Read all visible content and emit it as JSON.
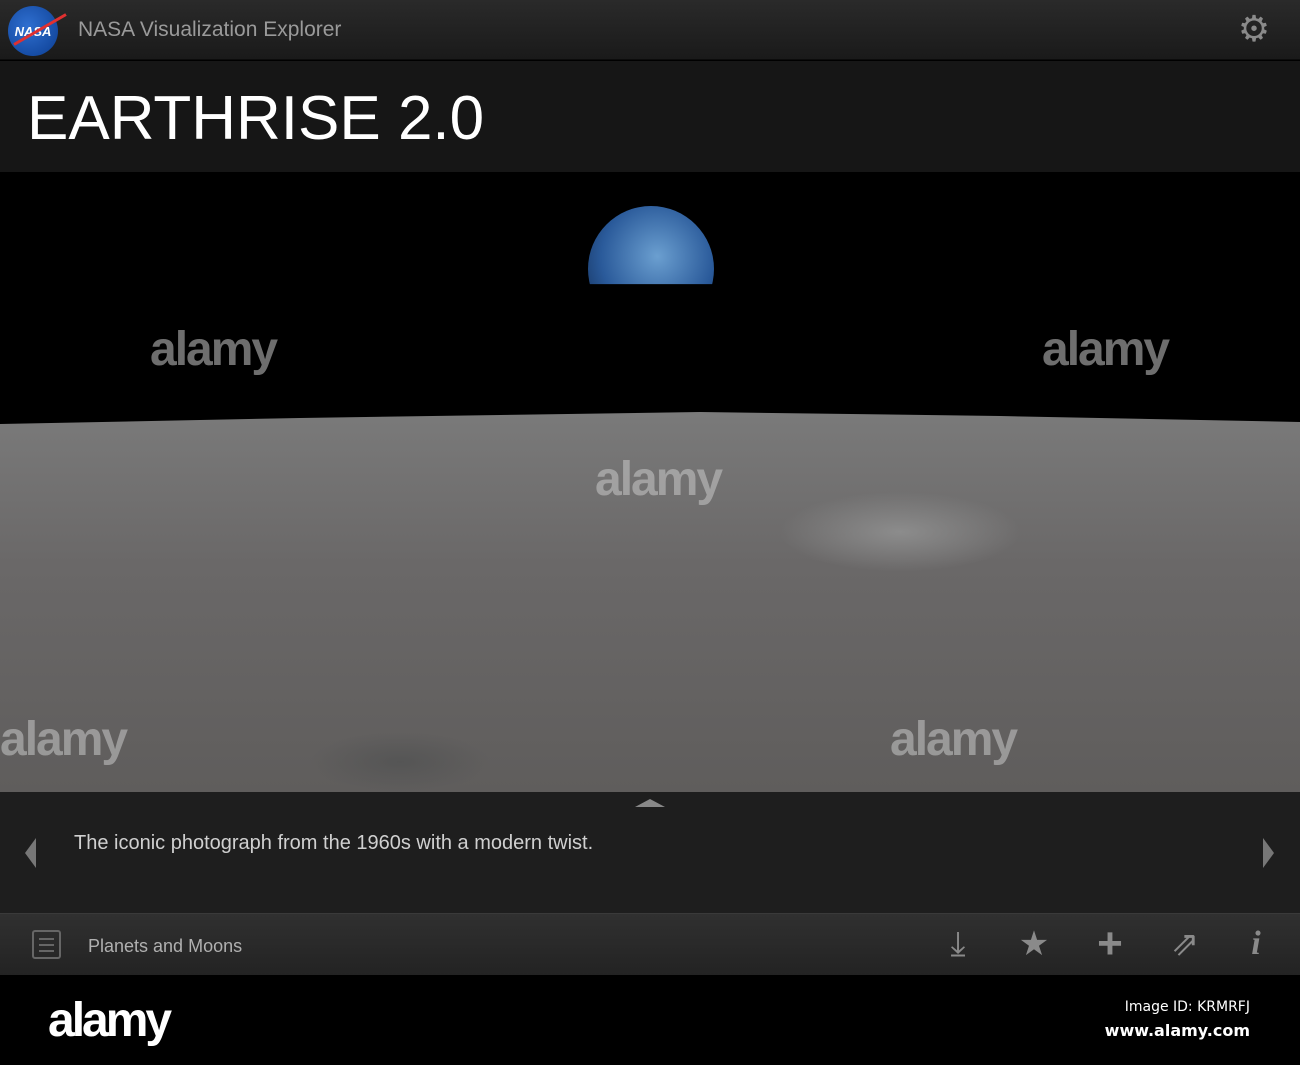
{
  "header": {
    "logo_text": "NASA",
    "app_title": "NASA Visualization Explorer",
    "settings_icon": "gear-icon"
  },
  "title": "EARTHRISE 2.0",
  "caption": "The iconic photograph from the 1960s with a modern twist.",
  "toolbar": {
    "category": "Planets and Moons",
    "icons": [
      "list-icon",
      "download-icon",
      "star-icon",
      "plus-icon",
      "share-icon",
      "info-icon"
    ]
  },
  "watermark": {
    "word": "alamy",
    "letter": "a"
  },
  "footer": {
    "image_id": "Image ID: KRMRFJ",
    "site": "www.alamy.com"
  }
}
